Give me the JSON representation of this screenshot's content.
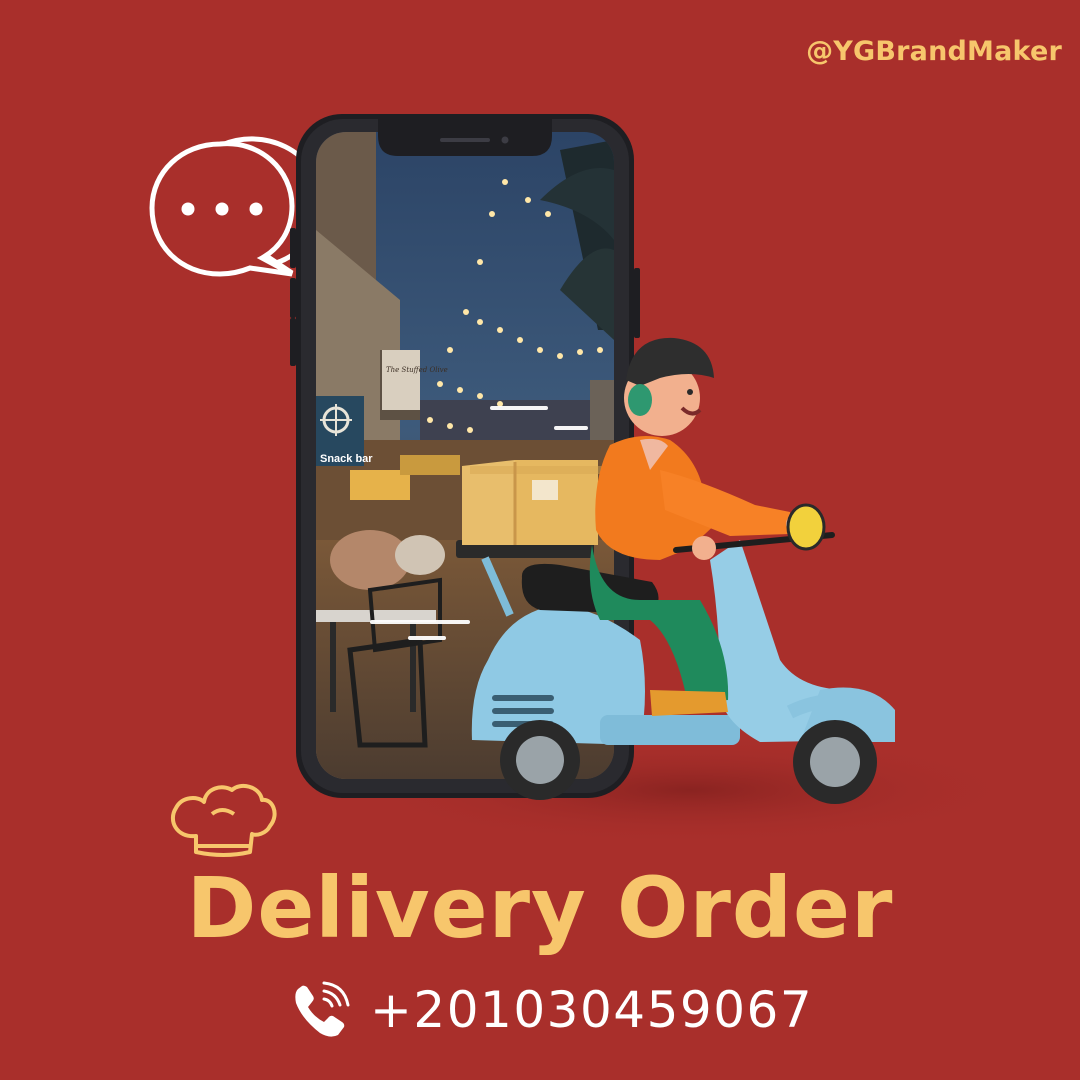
{
  "brand": {
    "handle": "@YGBrandMaker"
  },
  "headline": {
    "title": "Delivery Order"
  },
  "contact": {
    "phone": "+201030459067",
    "icon": "phone-icon"
  },
  "illustration": {
    "phone_screen_photo": {
      "sign_snack_bar": "Snack bar",
      "sign_restaurant": "The Stuffed Olive"
    },
    "icons": [
      "chat-bubble-icon",
      "chef-hat-icon",
      "delivery-scooter-illustration"
    ]
  },
  "colors": {
    "background": "#A92F2B",
    "accent": "#F7C66C",
    "text_light": "#FFFFFF",
    "scooter": "#8FC9E4"
  }
}
